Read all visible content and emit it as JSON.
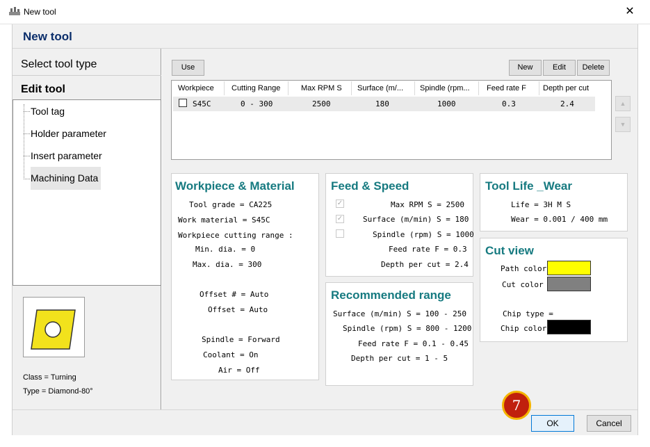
{
  "window": {
    "title": "New tool",
    "close_glyph": "✕"
  },
  "header": {
    "title": "New tool"
  },
  "left": {
    "select_tool_type": "Select tool type",
    "edit_tool": "Edit tool",
    "tree": [
      "Tool tag",
      "Holder parameter",
      "Insert parameter",
      "Machining Data"
    ],
    "selected_tree_item": "Machining Data",
    "insert_class": "Class = Turning",
    "insert_type": "Type = Diamond-80°",
    "insert_color": "#f2e21c"
  },
  "toolbar": {
    "use": "Use",
    "new": "New",
    "edit": "Edit",
    "delete": "Delete"
  },
  "grid": {
    "columns": [
      "Workpiece",
      "Cutting Range",
      "Max RPM S",
      "Surface (m/...",
      "Spindle (rpm...",
      "Feed rate F",
      "Depth per cut"
    ],
    "rows": [
      {
        "checked": false,
        "workpiece": "S45C",
        "cutting_range": "0 - 300",
        "max_rpm": "2500",
        "surface": "180",
        "spindle": "1000",
        "feed_rate": "0.3",
        "depth": "2.4"
      }
    ],
    "up_icon": "up-arrow-icon",
    "down_icon": "down-arrow-icon"
  },
  "workpiece_material": {
    "title": "Workpiece & Material",
    "tool_grade": "Tool grade =  CA225",
    "work_material": "Work material =  S45C",
    "cutting_range_label": "Workpiece cutting range :",
    "min_dia": "Min. dia. =  0",
    "max_dia": "Max. dia. =  300",
    "offset_num": "Offset # =  Auto",
    "offset": "Offset =  Auto",
    "spindle": "Spindle =  Forward",
    "coolant": "Coolant =  On",
    "air": "Air =  Off"
  },
  "feed_speed": {
    "title": "Feed & Speed",
    "max_rpm": "Max RPM S =  2500",
    "surface": "Surface (m/min) S =  180",
    "spindle": "Spindle (rpm) S =  1000",
    "feed_rate": "Feed rate F =  0.3",
    "depth": "Depth per cut =  2.4",
    "max_rpm_checked": true,
    "surface_checked": true,
    "spindle_checked": false
  },
  "recommended": {
    "title": "Recommended range",
    "surface": "Surface (m/min) S =  100 - 250",
    "spindle": "Spindle (rpm) S =  800 - 1200",
    "feed_rate": "Feed rate F =  0.1 - 0.45",
    "depth": "Depth per cut =  1 - 5"
  },
  "tool_life": {
    "title": "Tool Life _Wear",
    "life": "Life =  3H  M  S",
    "wear": "Wear =  0.001 / 400 mm"
  },
  "cut_view": {
    "title": "Cut view",
    "path_color_label": "Path color =",
    "path_color": "#ffff00",
    "cut_color_label": "Cut color =",
    "cut_color": "#808080",
    "chip_type_label": "Chip type =",
    "chip_color_label": "Chip color =",
    "chip_color": "#000000"
  },
  "footer": {
    "ok": "OK",
    "cancel": "Cancel",
    "step_badge": "7"
  },
  "colors": {
    "accent_title": "#167a80",
    "header_title": "#0b2e6b",
    "badge": "#c0200d"
  }
}
